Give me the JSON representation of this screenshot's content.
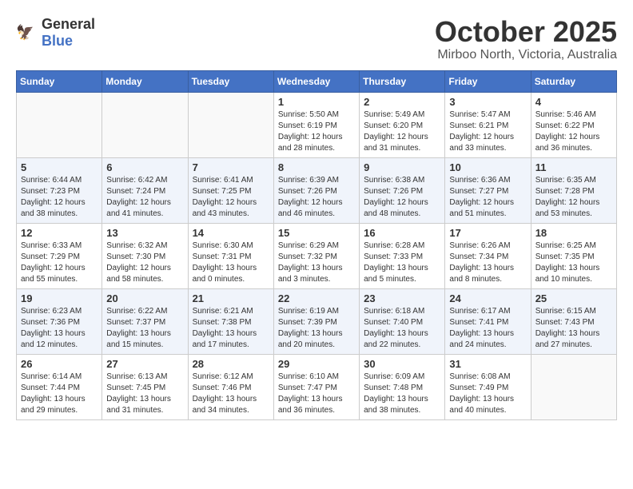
{
  "header": {
    "logo_general": "General",
    "logo_blue": "Blue",
    "month_title": "October 2025",
    "location": "Mirboo North, Victoria, Australia"
  },
  "weekdays": [
    "Sunday",
    "Monday",
    "Tuesday",
    "Wednesday",
    "Thursday",
    "Friday",
    "Saturday"
  ],
  "weeks": [
    [
      {
        "day": "",
        "info": ""
      },
      {
        "day": "",
        "info": ""
      },
      {
        "day": "",
        "info": ""
      },
      {
        "day": "1",
        "info": "Sunrise: 5:50 AM\nSunset: 6:19 PM\nDaylight: 12 hours\nand 28 minutes."
      },
      {
        "day": "2",
        "info": "Sunrise: 5:49 AM\nSunset: 6:20 PM\nDaylight: 12 hours\nand 31 minutes."
      },
      {
        "day": "3",
        "info": "Sunrise: 5:47 AM\nSunset: 6:21 PM\nDaylight: 12 hours\nand 33 minutes."
      },
      {
        "day": "4",
        "info": "Sunrise: 5:46 AM\nSunset: 6:22 PM\nDaylight: 12 hours\nand 36 minutes."
      }
    ],
    [
      {
        "day": "5",
        "info": "Sunrise: 6:44 AM\nSunset: 7:23 PM\nDaylight: 12 hours\nand 38 minutes."
      },
      {
        "day": "6",
        "info": "Sunrise: 6:42 AM\nSunset: 7:24 PM\nDaylight: 12 hours\nand 41 minutes."
      },
      {
        "day": "7",
        "info": "Sunrise: 6:41 AM\nSunset: 7:25 PM\nDaylight: 12 hours\nand 43 minutes."
      },
      {
        "day": "8",
        "info": "Sunrise: 6:39 AM\nSunset: 7:26 PM\nDaylight: 12 hours\nand 46 minutes."
      },
      {
        "day": "9",
        "info": "Sunrise: 6:38 AM\nSunset: 7:26 PM\nDaylight: 12 hours\nand 48 minutes."
      },
      {
        "day": "10",
        "info": "Sunrise: 6:36 AM\nSunset: 7:27 PM\nDaylight: 12 hours\nand 51 minutes."
      },
      {
        "day": "11",
        "info": "Sunrise: 6:35 AM\nSunset: 7:28 PM\nDaylight: 12 hours\nand 53 minutes."
      }
    ],
    [
      {
        "day": "12",
        "info": "Sunrise: 6:33 AM\nSunset: 7:29 PM\nDaylight: 12 hours\nand 55 minutes."
      },
      {
        "day": "13",
        "info": "Sunrise: 6:32 AM\nSunset: 7:30 PM\nDaylight: 12 hours\nand 58 minutes."
      },
      {
        "day": "14",
        "info": "Sunrise: 6:30 AM\nSunset: 7:31 PM\nDaylight: 13 hours\nand 0 minutes."
      },
      {
        "day": "15",
        "info": "Sunrise: 6:29 AM\nSunset: 7:32 PM\nDaylight: 13 hours\nand 3 minutes."
      },
      {
        "day": "16",
        "info": "Sunrise: 6:28 AM\nSunset: 7:33 PM\nDaylight: 13 hours\nand 5 minutes."
      },
      {
        "day": "17",
        "info": "Sunrise: 6:26 AM\nSunset: 7:34 PM\nDaylight: 13 hours\nand 8 minutes."
      },
      {
        "day": "18",
        "info": "Sunrise: 6:25 AM\nSunset: 7:35 PM\nDaylight: 13 hours\nand 10 minutes."
      }
    ],
    [
      {
        "day": "19",
        "info": "Sunrise: 6:23 AM\nSunset: 7:36 PM\nDaylight: 13 hours\nand 12 minutes."
      },
      {
        "day": "20",
        "info": "Sunrise: 6:22 AM\nSunset: 7:37 PM\nDaylight: 13 hours\nand 15 minutes."
      },
      {
        "day": "21",
        "info": "Sunrise: 6:21 AM\nSunset: 7:38 PM\nDaylight: 13 hours\nand 17 minutes."
      },
      {
        "day": "22",
        "info": "Sunrise: 6:19 AM\nSunset: 7:39 PM\nDaylight: 13 hours\nand 20 minutes."
      },
      {
        "day": "23",
        "info": "Sunrise: 6:18 AM\nSunset: 7:40 PM\nDaylight: 13 hours\nand 22 minutes."
      },
      {
        "day": "24",
        "info": "Sunrise: 6:17 AM\nSunset: 7:41 PM\nDaylight: 13 hours\nand 24 minutes."
      },
      {
        "day": "25",
        "info": "Sunrise: 6:15 AM\nSunset: 7:43 PM\nDaylight: 13 hours\nand 27 minutes."
      }
    ],
    [
      {
        "day": "26",
        "info": "Sunrise: 6:14 AM\nSunset: 7:44 PM\nDaylight: 13 hours\nand 29 minutes."
      },
      {
        "day": "27",
        "info": "Sunrise: 6:13 AM\nSunset: 7:45 PM\nDaylight: 13 hours\nand 31 minutes."
      },
      {
        "day": "28",
        "info": "Sunrise: 6:12 AM\nSunset: 7:46 PM\nDaylight: 13 hours\nand 34 minutes."
      },
      {
        "day": "29",
        "info": "Sunrise: 6:10 AM\nSunset: 7:47 PM\nDaylight: 13 hours\nand 36 minutes."
      },
      {
        "day": "30",
        "info": "Sunrise: 6:09 AM\nSunset: 7:48 PM\nDaylight: 13 hours\nand 38 minutes."
      },
      {
        "day": "31",
        "info": "Sunrise: 6:08 AM\nSunset: 7:49 PM\nDaylight: 13 hours\nand 40 minutes."
      },
      {
        "day": "",
        "info": ""
      }
    ]
  ]
}
